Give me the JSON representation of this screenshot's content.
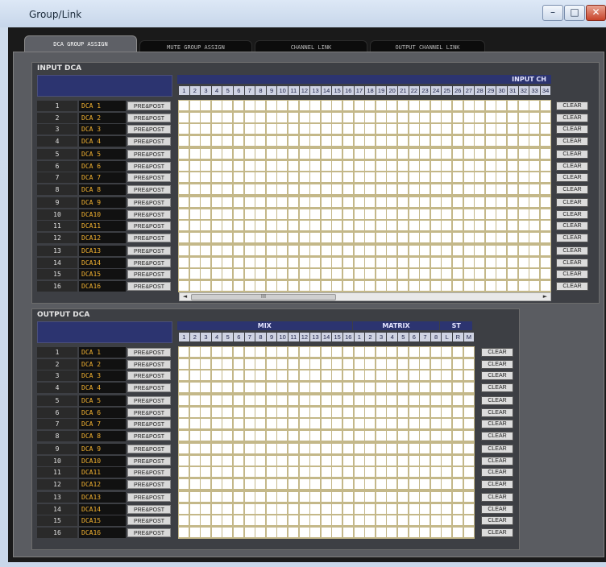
{
  "window": {
    "title": "Group/Link"
  },
  "tabs": [
    {
      "label": "DCA GROUP ASSIGN",
      "active": true
    },
    {
      "label": "MUTE GROUP ASSIGN",
      "active": false
    },
    {
      "label": "CHANNEL LINK",
      "active": false
    },
    {
      "label": "OUTPUT CHANNEL LINK",
      "active": false
    }
  ],
  "input_dca": {
    "title": "INPUT DCA",
    "header_label": "INPUT CH",
    "channels": [
      "1",
      "2",
      "3",
      "4",
      "5",
      "6",
      "7",
      "8",
      "9",
      "10",
      "11",
      "12",
      "13",
      "14",
      "15",
      "16",
      "17",
      "18",
      "19",
      "20",
      "21",
      "22",
      "23",
      "24",
      "25",
      "26",
      "27",
      "28",
      "29",
      "30",
      "31",
      "32",
      "33",
      "34"
    ],
    "rows": [
      {
        "num": "1",
        "name": "DCA 1"
      },
      {
        "num": "2",
        "name": "DCA 2"
      },
      {
        "num": "3",
        "name": "DCA 3"
      },
      {
        "num": "4",
        "name": "DCA 4"
      },
      {
        "num": "5",
        "name": "DCA 5"
      },
      {
        "num": "6",
        "name": "DCA 6"
      },
      {
        "num": "7",
        "name": "DCA 7"
      },
      {
        "num": "8",
        "name": "DCA 8"
      },
      {
        "num": "9",
        "name": "DCA 9"
      },
      {
        "num": "10",
        "name": "DCA10"
      },
      {
        "num": "11",
        "name": "DCA11"
      },
      {
        "num": "12",
        "name": "DCA12"
      },
      {
        "num": "13",
        "name": "DCA13"
      },
      {
        "num": "14",
        "name": "DCA14"
      },
      {
        "num": "15",
        "name": "DCA15"
      },
      {
        "num": "16",
        "name": "DCA16"
      }
    ],
    "prepost_label": "PRE&POST",
    "clear_label": "CLEAR",
    "scroll_grip": "III"
  },
  "output_dca": {
    "title": "OUTPUT DCA",
    "groups": [
      {
        "label": "MIX",
        "channels": [
          "1",
          "2",
          "3",
          "4",
          "5",
          "6",
          "7",
          "8",
          "9",
          "10",
          "11",
          "12",
          "13",
          "14",
          "15",
          "16"
        ]
      },
      {
        "label": "MATRIX",
        "channels": [
          "1",
          "2",
          "3",
          "4",
          "5",
          "6",
          "7",
          "8"
        ]
      },
      {
        "label": "ST",
        "channels": [
          "L",
          "R",
          "M"
        ]
      }
    ],
    "rows": [
      {
        "num": "1",
        "name": "DCA 1"
      },
      {
        "num": "2",
        "name": "DCA 2"
      },
      {
        "num": "3",
        "name": "DCA 3"
      },
      {
        "num": "4",
        "name": "DCA 4"
      },
      {
        "num": "5",
        "name": "DCA 5"
      },
      {
        "num": "6",
        "name": "DCA 6"
      },
      {
        "num": "7",
        "name": "DCA 7"
      },
      {
        "num": "8",
        "name": "DCA 8"
      },
      {
        "num": "9",
        "name": "DCA 9"
      },
      {
        "num": "10",
        "name": "DCA10"
      },
      {
        "num": "11",
        "name": "DCA11"
      },
      {
        "num": "12",
        "name": "DCA12"
      },
      {
        "num": "13",
        "name": "DCA13"
      },
      {
        "num": "14",
        "name": "DCA14"
      },
      {
        "num": "15",
        "name": "DCA15"
      },
      {
        "num": "16",
        "name": "DCA16"
      }
    ],
    "prepost_label": "PRE&POST",
    "clear_label": "CLEAR"
  },
  "icons": {
    "minimize": "–",
    "maximize": "□",
    "close": "✕",
    "scroll_left": "◄",
    "scroll_right": "►"
  }
}
